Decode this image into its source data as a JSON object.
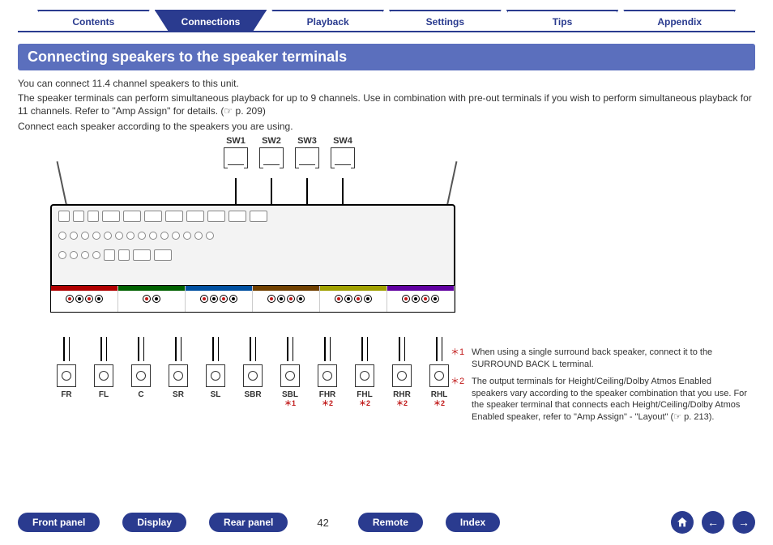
{
  "tabs": {
    "items": [
      "Contents",
      "Connections",
      "Playback",
      "Settings",
      "Tips",
      "Appendix"
    ],
    "active_index": 1
  },
  "section_title": "Connecting speakers to the speaker terminals",
  "paragraphs": {
    "p1": "You can connect 11.4 channel speakers to this unit.",
    "p2a": "The speaker terminals can perform simultaneous playback for up to 9 channels. Use in combination with pre-out terminals if you wish to perform simultaneous playback for 11 channels. Refer to \"Amp Assign\" for details.  (",
    "p2b": "p. 209)",
    "p3": "Connect each speaker according to the speakers you are using."
  },
  "diagram": {
    "subwoofers": [
      "SW1",
      "SW2",
      "SW3",
      "SW4"
    ],
    "speakers": [
      {
        "label": "FR",
        "note": "",
        "group": "front"
      },
      {
        "label": "FL",
        "note": "",
        "group": "front"
      },
      {
        "label": "C",
        "note": "",
        "group": "center"
      },
      {
        "label": "SR",
        "note": "",
        "group": "surround"
      },
      {
        "label": "SL",
        "note": "",
        "group": "surround"
      },
      {
        "label": "SBR",
        "note": "",
        "group": "sback"
      },
      {
        "label": "SBL",
        "note": "＊1",
        "group": "sback"
      },
      {
        "label": "FHR",
        "note": "＊2",
        "group": "h1"
      },
      {
        "label": "FHL",
        "note": "＊2",
        "group": "h1"
      },
      {
        "label": "RHR",
        "note": "＊2",
        "group": "h2"
      },
      {
        "label": "RHL",
        "note": "＊2",
        "group": "h2"
      }
    ]
  },
  "footnotes": {
    "f1_mark": "＊1",
    "f1_text": "When using a single surround back speaker, connect it to the SURROUND BACK L terminal.",
    "f2_mark": "＊2",
    "f2_text_a": "The output terminals for Height/Ceiling/Dolby Atmos Enabled speakers vary according to the speaker combination that you use. For the speaker terminal that connects each Height/Ceiling/Dolby Atmos Enabled speaker, refer to \"Amp Assign\" - \"Layout\" (",
    "f2_text_b": "p. 213)."
  },
  "bottom_nav": {
    "items": [
      "Front panel",
      "Display",
      "Rear panel",
      "Remote",
      "Index"
    ],
    "page": "42"
  },
  "icons": {
    "home": "home-icon",
    "prev": "arrow-left-icon",
    "next": "arrow-right-icon"
  }
}
